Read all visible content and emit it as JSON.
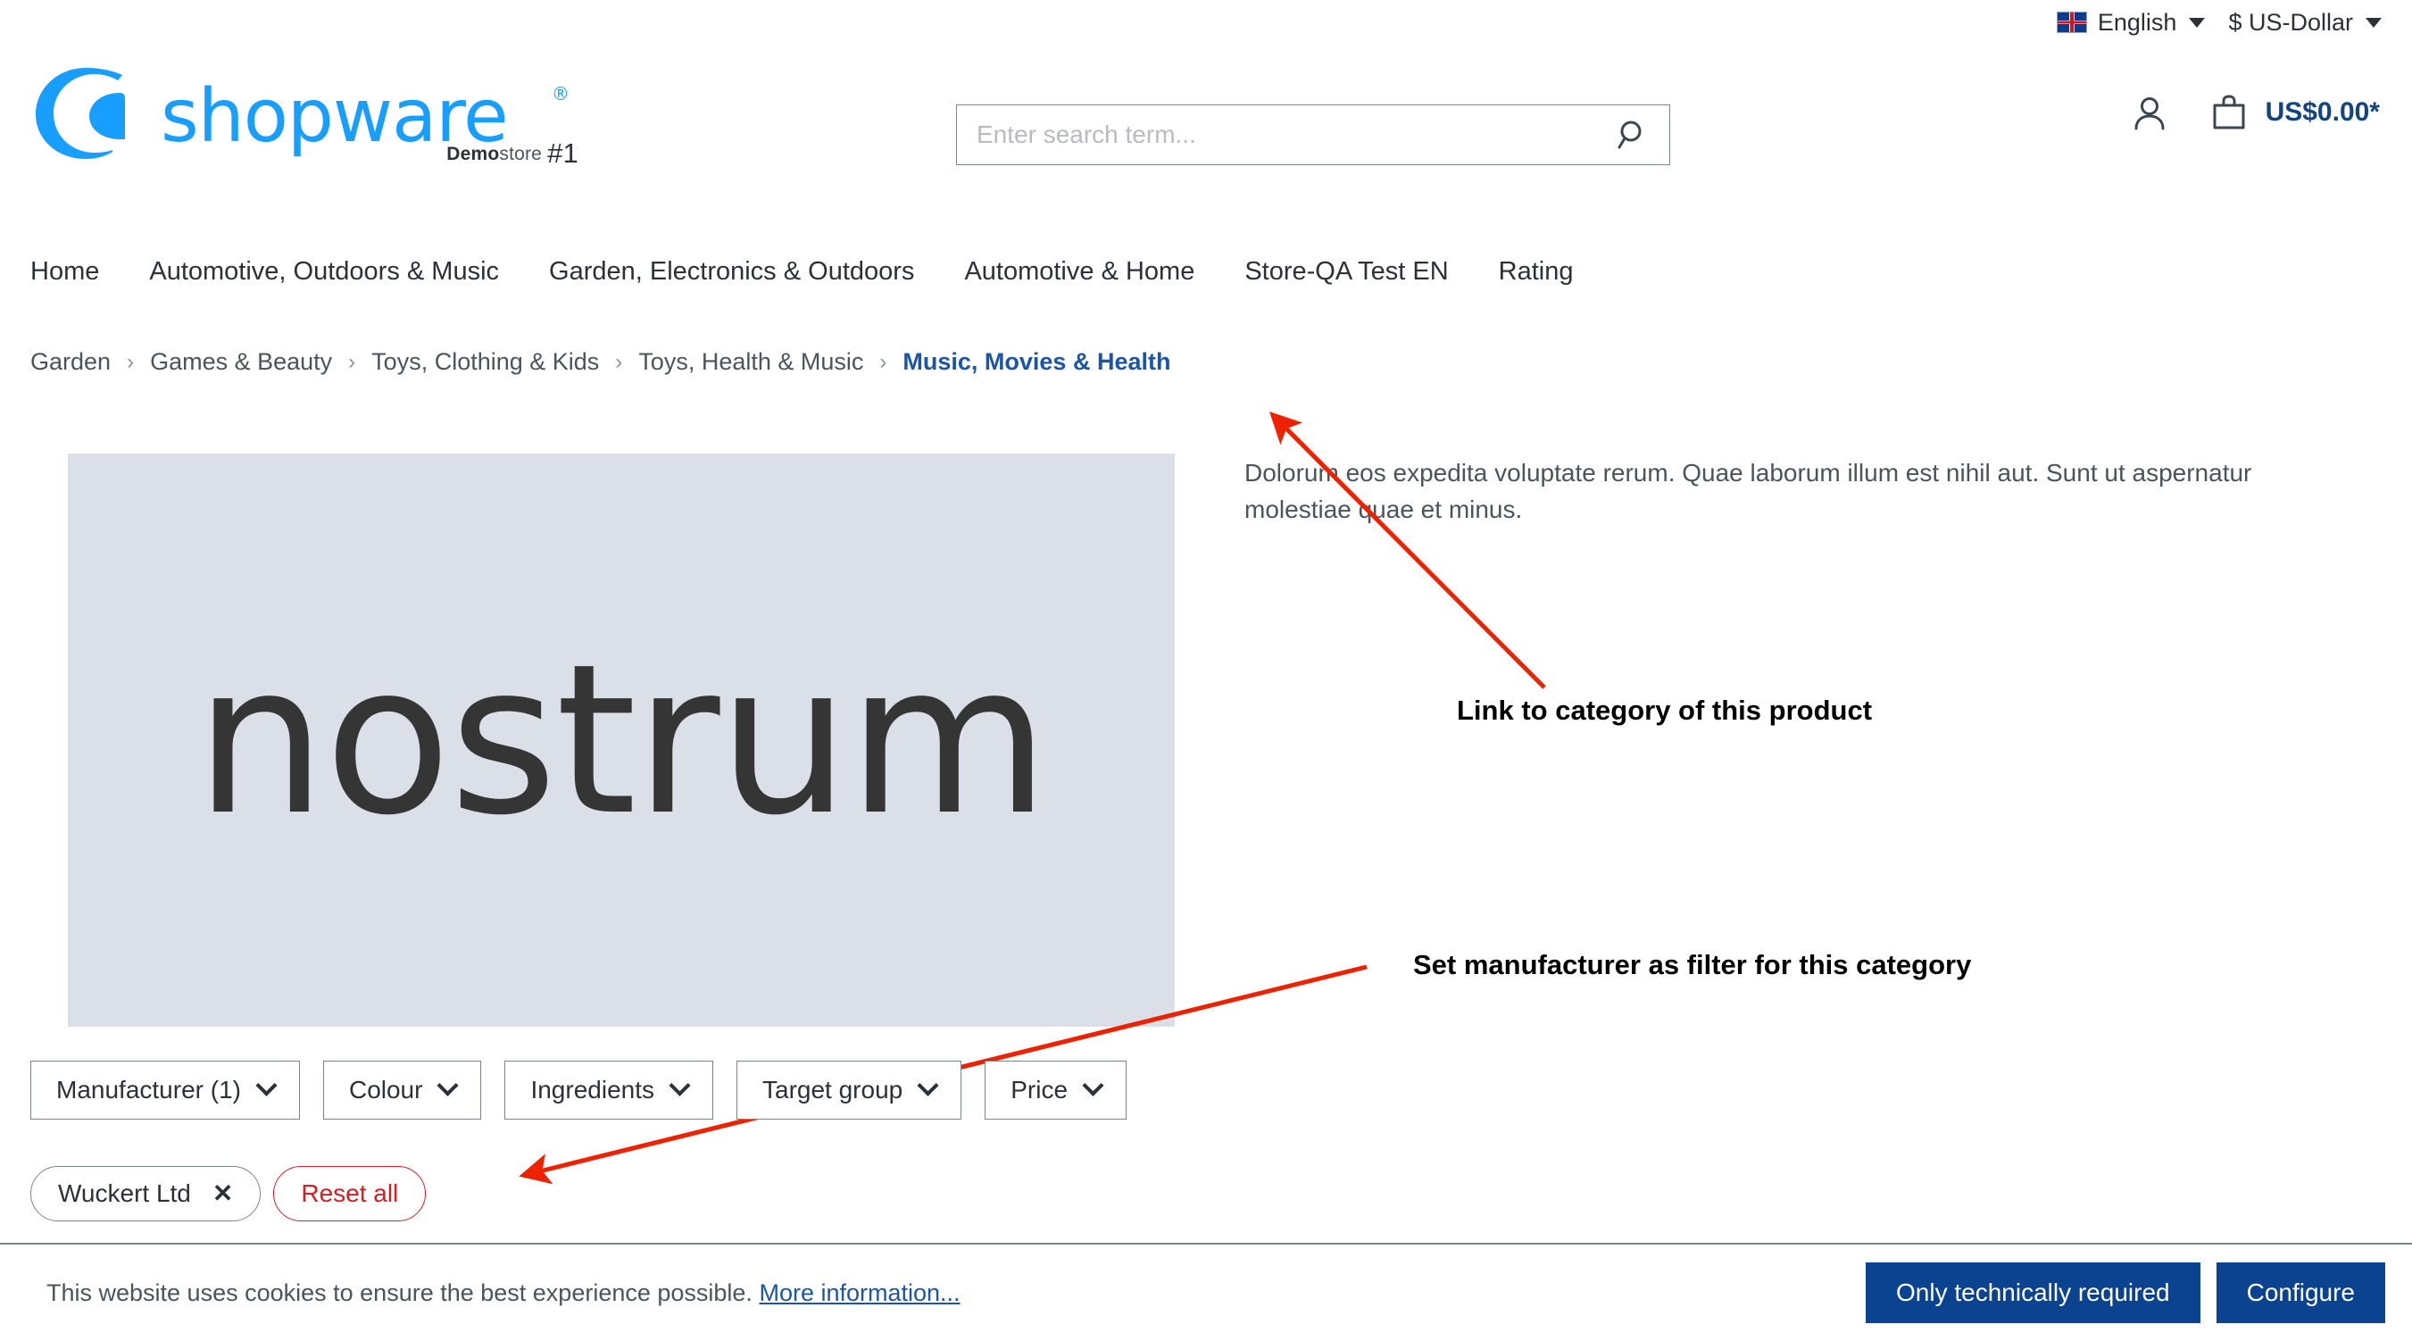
{
  "topbar": {
    "language": "English",
    "currency": "$ US-Dollar",
    "flag_icon": "uk-flag-icon"
  },
  "header": {
    "logo_text": "shopware",
    "demostore_bold": "Demo",
    "demostore_rest": "store",
    "demostore_hash": "#1",
    "search": {
      "placeholder": "Enter search term...",
      "value": "",
      "icon": "search-icon"
    },
    "account_icon": "user-icon",
    "cart_icon": "shopping-bag-icon",
    "cart_total": "US$0.00*"
  },
  "nav": {
    "items": [
      {
        "label": "Home"
      },
      {
        "label": "Automotive, Outdoors & Music"
      },
      {
        "label": "Garden, Electronics & Outdoors"
      },
      {
        "label": "Automotive & Home"
      },
      {
        "label": "Store-QA Test EN"
      },
      {
        "label": "Rating"
      }
    ]
  },
  "breadcrumb": {
    "separator": "›",
    "items": [
      {
        "label": "Garden",
        "active": false
      },
      {
        "label": "Games & Beauty",
        "active": false
      },
      {
        "label": "Toys, Clothing & Kids",
        "active": false
      },
      {
        "label": "Toys, Health & Music",
        "active": false
      },
      {
        "label": "Music, Movies & Health",
        "active": true
      }
    ]
  },
  "product": {
    "image_placeholder_text": "nostrum",
    "description": "Dolorum eos expedita voluptate rerum. Quae laborum illum est nihil aut. Sunt ut aspernatur molestiae quae et minus."
  },
  "annotations": [
    {
      "text": "Link to category of this product"
    },
    {
      "text": "Set manufacturer as filter for this category"
    }
  ],
  "filters": {
    "buttons": [
      {
        "label": "Manufacturer  (1)",
        "icon": "chevron-down-icon"
      },
      {
        "label": "Colour",
        "icon": "chevron-down-icon"
      },
      {
        "label": "Ingredients",
        "icon": "chevron-down-icon"
      },
      {
        "label": "Target group",
        "icon": "chevron-down-icon"
      },
      {
        "label": "Price",
        "icon": "chevron-down-icon"
      }
    ],
    "active_chip": {
      "label": "Wuckert Ltd",
      "remove_icon": "✕"
    },
    "reset_label": "Reset all"
  },
  "cookie_banner": {
    "text": "This website uses cookies to ensure the best experience possible.",
    "link": "More information...",
    "primary_button": "Only technically required",
    "secondary_button": "Configure"
  },
  "colors": {
    "brand_blue": "#189eff",
    "accent_dark_blue": "#0b4391",
    "link_blue": "#1b55a5",
    "annotation_red": "#ee2200",
    "reset_red": "#d81b22",
    "image_placeholder_bg": "#dbdfe7",
    "border_grey": "#798490"
  }
}
